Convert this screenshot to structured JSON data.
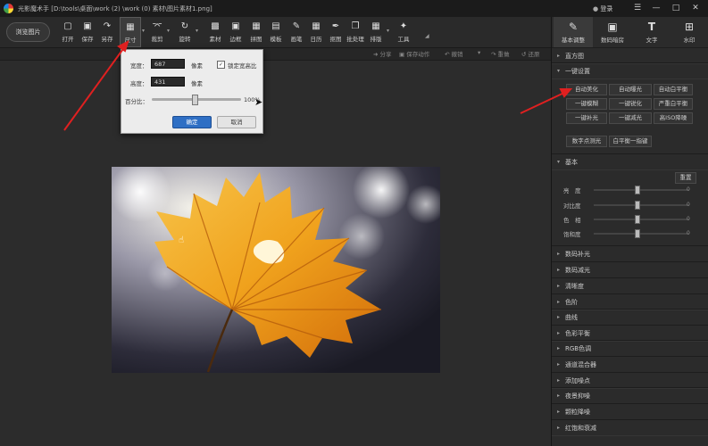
{
  "window": {
    "title": "光影魔术手 [D:\\tools\\桌面\\work (2) \\work (0) 素材\\图片素材1.png]",
    "login_label": "登录"
  },
  "toolbar": {
    "browse_label": "浏览图片",
    "items": [
      {
        "label": "打开",
        "icon": "folder-open-icon"
      },
      {
        "label": "保存",
        "icon": "save-icon"
      },
      {
        "label": "另存",
        "icon": "save-as-icon"
      },
      {
        "label": "尺寸",
        "icon": "resize-icon"
      },
      {
        "label": "裁剪",
        "icon": "crop-icon"
      },
      {
        "label": "旋转",
        "icon": "rotate-icon"
      },
      {
        "label": "素材",
        "icon": "material-icon"
      },
      {
        "label": "边框",
        "icon": "border-icon"
      },
      {
        "label": "拼图",
        "icon": "collage-icon"
      },
      {
        "label": "模板",
        "icon": "template-icon"
      },
      {
        "label": "画笔",
        "icon": "brush-icon"
      },
      {
        "label": "日历",
        "icon": "calendar-icon"
      },
      {
        "label": "抠图",
        "icon": "cutout-icon"
      },
      {
        "label": "批处理",
        "icon": "batch-icon"
      },
      {
        "label": "排版",
        "icon": "layout-icon"
      },
      {
        "label": "工具",
        "icon": "tools-icon"
      }
    ]
  },
  "subbar": {
    "share": "分享",
    "save_action": "保存动作",
    "undo": "撤销",
    "redo": "重做",
    "restore": "还原"
  },
  "resize_popup": {
    "width_label": "宽度：",
    "width_value": "687",
    "height_label": "高度：",
    "height_value": "431",
    "unit": "像素",
    "lock_label": "锁定宽高比",
    "lock_checked": true,
    "percent_label": "百分比：",
    "percent_value": "100%",
    "percent_level": 100,
    "ok_label": "确定",
    "cancel_label": "取消"
  },
  "right_tabs": [
    {
      "label": "基本调整",
      "icon": "edit-icon"
    },
    {
      "label": "数码暗房",
      "icon": "camera-icon"
    },
    {
      "label": "文字",
      "icon": "text-icon"
    },
    {
      "label": "水印",
      "icon": "watermark-icon"
    }
  ],
  "right_panel": {
    "histogram": "直方图",
    "one_click": "一键设置",
    "quick_buttons": [
      "自动美化",
      "自动曝光",
      "自动白平衡",
      "一键模糊",
      "一键锐化",
      "严重白平衡",
      "一键补光",
      "一键减光",
      "高ISO降噪",
      "数字点测光",
      "白平衡一指键"
    ],
    "basic": "基本",
    "reset_label": "重置",
    "adjustments": [
      {
        "label": "亮　度",
        "value": "0"
      },
      {
        "label": "对比度",
        "value": "0"
      },
      {
        "label": "色　相",
        "value": "0"
      },
      {
        "label": "饱和度",
        "value": "0"
      }
    ],
    "sections": [
      "数码补光",
      "数码减光",
      "清晰度",
      "色阶",
      "曲线",
      "色彩平衡",
      "RGB色调",
      "通道混合器",
      "添加噪点",
      "夜景抑噪",
      "颗粒降噪",
      "红饱和衰减"
    ]
  },
  "colors": {
    "accent_blue": "#2f6fc4",
    "annotation_red": "#e02020"
  }
}
